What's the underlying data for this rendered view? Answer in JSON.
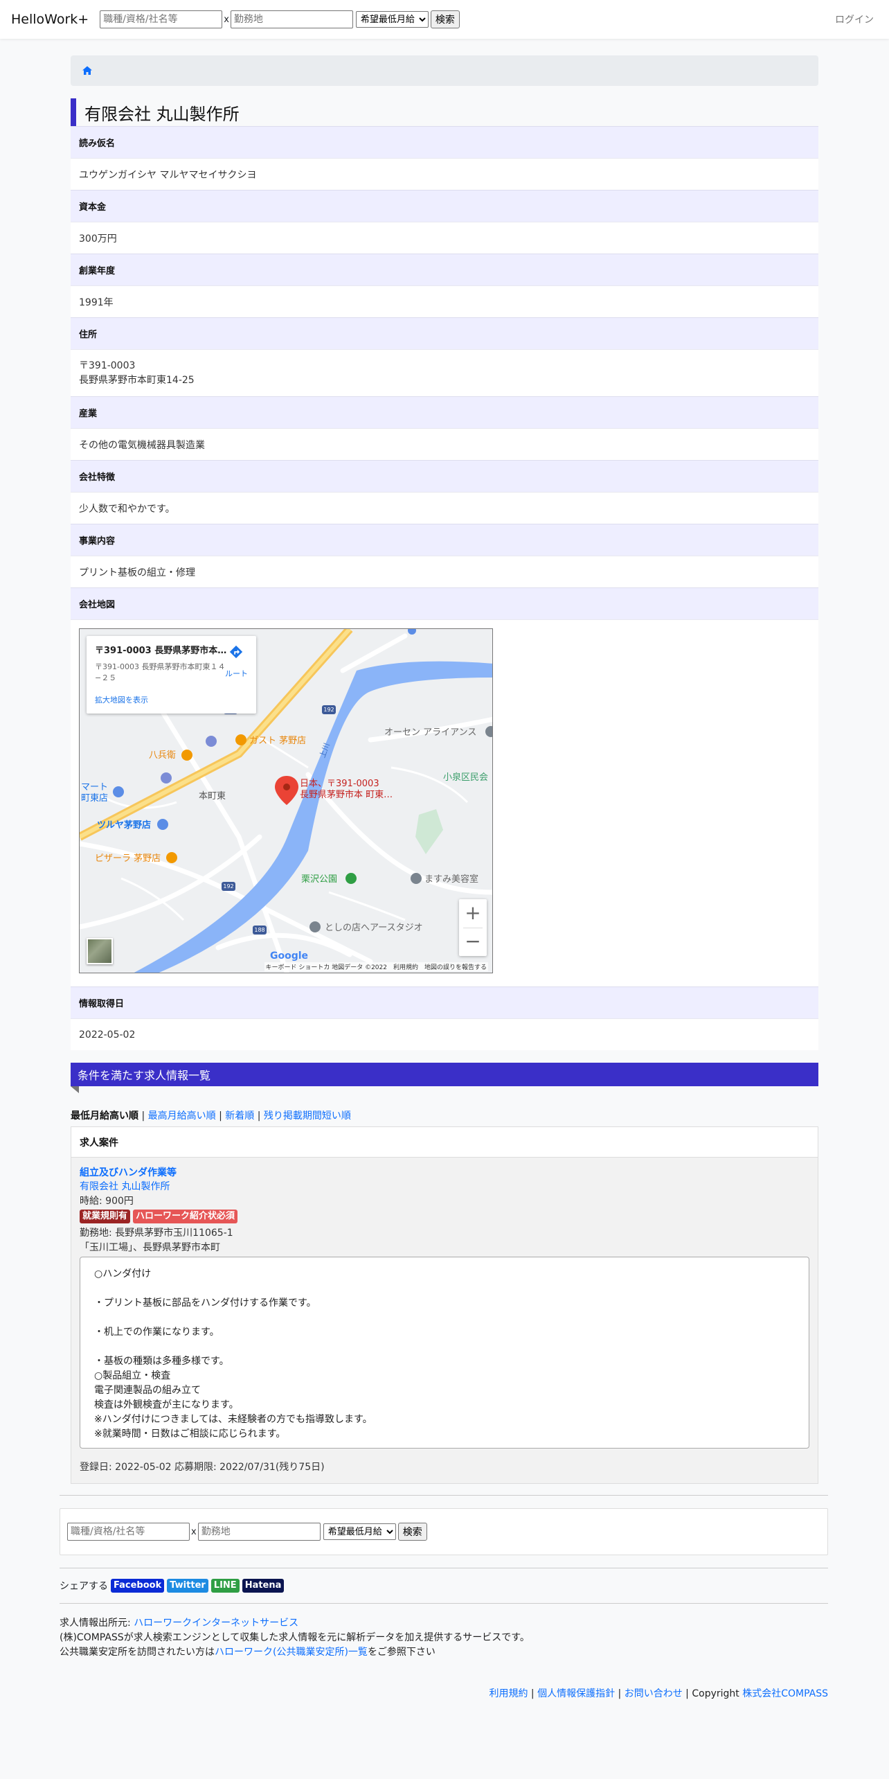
{
  "nav": {
    "brand": "HelloWork+",
    "job_placeholder": "職種/資格/社名等",
    "location_placeholder": "勤務地",
    "separator": "x",
    "salary_option": "希望最低月給",
    "search_label": "検索",
    "login_label": "ログイン"
  },
  "company": {
    "name": "有限会社 丸山製作所",
    "fields": {
      "kana_label": "読み仮名",
      "kana": "ユウゲンガイシヤ マルヤマセイサクシヨ",
      "capital_label": "資本金",
      "capital": "300万円",
      "founded_label": "創業年度",
      "founded": "1991年",
      "address_label": "住所",
      "postal": "〒391-0003",
      "address": "長野県茅野市本町東14-25",
      "industry_label": "産業",
      "industry": "その他の電気機械器具製造業",
      "feature_label": "会社特徴",
      "feature": "少人数で和やかです。",
      "business_label": "事業内容",
      "business": "プリント基板の組立・修理",
      "map_label": "会社地図",
      "retrieved_label": "情報取得日",
      "retrieved": "2022-05-02"
    }
  },
  "map": {
    "card_title": "〒391-0003 長野県茅野市本町...",
    "card_address": "〒391-0003 長野県茅野市本町東１４−２５",
    "card_link": "拡大地図を表示",
    "route_label": "ルート",
    "pin_label_1": "日本、〒391-0003",
    "pin_label_2": "長野県茅野市本 町東…",
    "places": {
      "gust": "ガスト 茅野店",
      "hachibei": "八兵衛",
      "mart": "マート",
      "mart2": "町東店",
      "honmachi": "本町東",
      "tsutaya": "ツルヤ茅野店",
      "pizza": "ピザーラ 茅野店",
      "osen": "オーセン アライアンス",
      "koizumi": "小泉区民会",
      "kurisawa": "栗沢公園",
      "masumi": "ますみ美容室",
      "toshino": "としの店へアースタジオ",
      "river": "上川"
    },
    "road_numbers": [
      "192",
      "192",
      "192",
      "188"
    ],
    "google": "Google",
    "footer": "キーボード ショートカ 地図データ ©2022　利用規約　地図の誤りを報告する",
    "zoom_in": "+",
    "zoom_out": "−"
  },
  "jobs": {
    "header": "条件を満たす求人情報一覧",
    "sort_active": "最低月給高い順",
    "sort_options": [
      "最高月給高い順",
      "新着順",
      "残り掲載期間短い順"
    ],
    "sort_sep": " | ",
    "card_header": "求人案件",
    "item": {
      "title": "組立及びハンダ作業等",
      "company": "有限会社 丸山製作所",
      "wage": "時給: 900円",
      "badge_1": "就業規則有",
      "badge_2": "ハローワーク紹介状必須",
      "location_1": "勤務地: 長野県茅野市玉川11065-1",
      "location_2": "「玉川工場」、長野県茅野市本町",
      "description": "○ハンダ付け\n\n・プリント基板に部品をハンダ付けする作業です。\n\n・机上での作業になります。\n\n・基板の種類は多種多様です。\n○製品組立・検査\n電子関連製品の組み立て\n検査は外観検査が主になります。\n※ハンダ付けにつきましては、未経験者の方でも指導致します。\n※就業時間・日数はご相談に応じられます。",
      "dates": "登録日: 2022-05-02 応募期限: 2022/07/31(残り75日)"
    }
  },
  "footer": {
    "share_label": "シェアする",
    "share_facebook": "Facebook",
    "share_twitter": "Twitter",
    "share_line": "LINE",
    "share_hatena": "Hatena",
    "source_prefix": "求人情報出所元: ",
    "source_link": "ハローワークインターネットサービス",
    "disclaimer": "(株)COMPASSが求人検索エンジンとして収集した求人情報を元に解析データを加え提供するサービスです。",
    "visit_prefix": "公共職業安定所を訪問されたい方は",
    "visit_link": "ハローワーク(公共職業安定所)一覧",
    "visit_suffix": "をご参照下さい",
    "links": [
      "利用規約",
      "個人情報保護指針",
      "お問い合わせ"
    ],
    "link_sep": " | ",
    "copyright_prefix": " | Copyright ",
    "copyright_link": "株式会社COMPASS"
  }
}
